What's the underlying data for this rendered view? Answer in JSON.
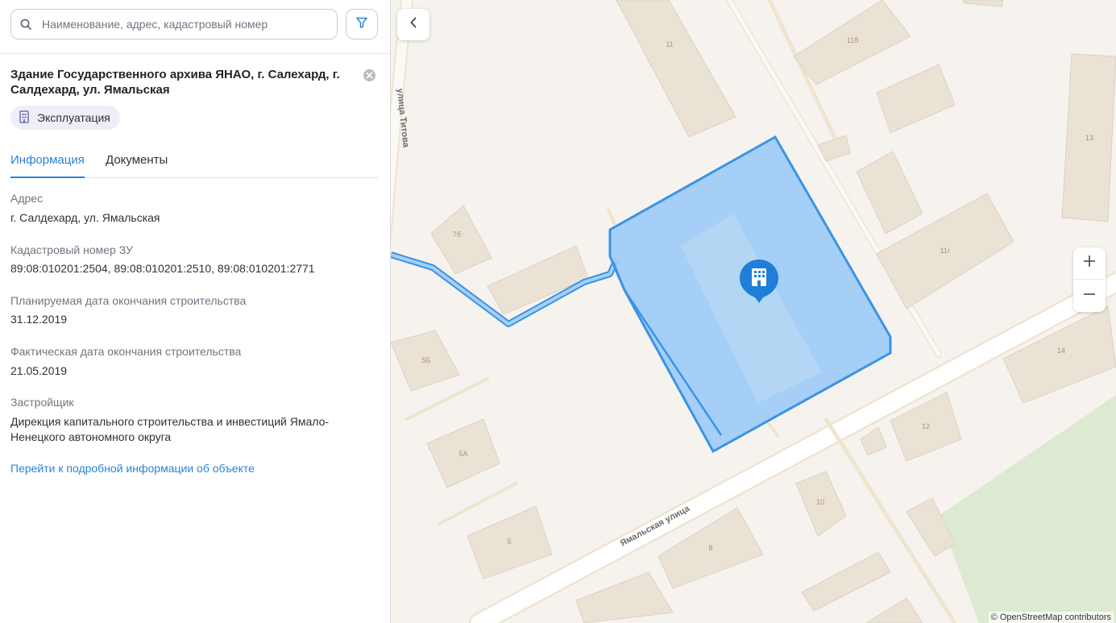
{
  "search": {
    "placeholder": "Наименование, адрес, кадастровый номер",
    "icon": "search-icon",
    "filter_icon": "filter-icon"
  },
  "object": {
    "title": "Здание Государственного архива ЯНАО, г. Салехард, г. Салдехард, ул. Ямальская",
    "status": "Эксплуатация",
    "status_icon": "building-icon"
  },
  "tabs": [
    {
      "label": "Информация",
      "active": true
    },
    {
      "label": "Документы",
      "active": false
    }
  ],
  "fields": [
    {
      "label": "Адрес",
      "value": "г. Салдехард, ул. Ямальская"
    },
    {
      "label": "Кадастровый номер ЗУ",
      "value": "89:08:010201:2504, 89:08:010201:2510, 89:08:010201:2771"
    },
    {
      "label": "Планируемая дата окончания строительства",
      "value": "31.12.2019"
    },
    {
      "label": "Фактическая дата окончания строительства",
      "value": "21.05.2019"
    },
    {
      "label": "Застройщик",
      "value": "Дирекция капитального строительства и инвестиций Ямало-Ненецкого автономного округа"
    }
  ],
  "detail_link": "Перейти к подробной информации об объекте",
  "map": {
    "streets": {
      "titova": "улица Титова",
      "yamalskaya": "Ямальская улица"
    },
    "house_numbers": [
      "11",
      "11б",
      "13",
      "11г",
      "14",
      "12",
      "10",
      "8",
      "5",
      "5А",
      "5Б",
      "7б"
    ],
    "attribution": "© OpenStreetMap contributors",
    "highlight_color": "#3a93e6"
  },
  "controls": {
    "zoom_in": "+",
    "zoom_out": "−"
  }
}
